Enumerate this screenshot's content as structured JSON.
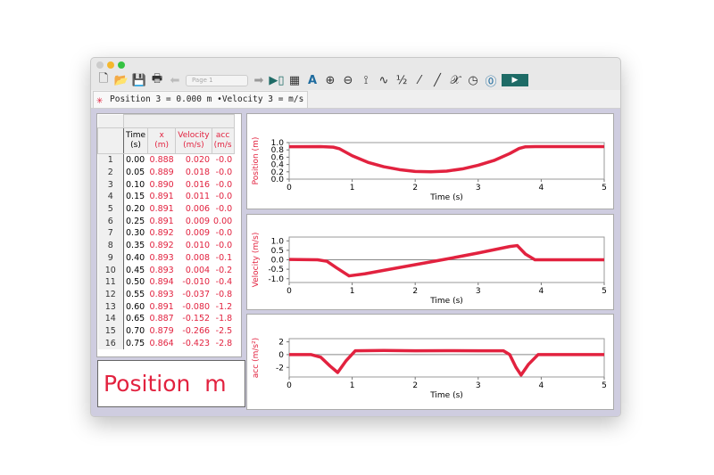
{
  "toolbar": {
    "page_select": "Page 1",
    "icons": [
      "new-file",
      "open-file",
      "save",
      "print",
      "back-arrow",
      "page-select",
      "forward-arrow",
      "data-browser",
      "calculator",
      "autoscale",
      "zoom-in",
      "zoom-out",
      "examine",
      "interpolate",
      "integral",
      "tangent",
      "linear-fit",
      "curve-fit",
      "stopwatch",
      "zero",
      "collect"
    ]
  },
  "tab": {
    "label": "Position 3 = 0.000 m •Velocity 3 =  m/s"
  },
  "table": {
    "headers": [
      {
        "name": "Time",
        "unit": "(s)"
      },
      {
        "name": "x",
        "unit": "(m)"
      },
      {
        "name": "Velocity",
        "unit": "(m/s)"
      },
      {
        "name": "acc",
        "unit": "(m/s"
      }
    ],
    "rows": [
      [
        "1",
        "0.00",
        "0.888",
        "0.020",
        "-0.0"
      ],
      [
        "2",
        "0.05",
        "0.889",
        "0.018",
        "-0.0"
      ],
      [
        "3",
        "0.10",
        "0.890",
        "0.016",
        "-0.0"
      ],
      [
        "4",
        "0.15",
        "0.891",
        "0.011",
        "-0.0"
      ],
      [
        "5",
        "0.20",
        "0.891",
        "0.006",
        "-0.0"
      ],
      [
        "6",
        "0.25",
        "0.891",
        "0.009",
        "0.00"
      ],
      [
        "7",
        "0.30",
        "0.892",
        "0.009",
        "-0.0"
      ],
      [
        "8",
        "0.35",
        "0.892",
        "0.010",
        "-0.0"
      ],
      [
        "9",
        "0.40",
        "0.893",
        "0.008",
        "-0.1"
      ],
      [
        "10",
        "0.45",
        "0.893",
        "0.004",
        "-0.2"
      ],
      [
        "11",
        "0.50",
        "0.894",
        "-0.010",
        "-0.4"
      ],
      [
        "12",
        "0.55",
        "0.893",
        "-0.037",
        "-0.8"
      ],
      [
        "13",
        "0.60",
        "0.891",
        "-0.080",
        "-1.2"
      ],
      [
        "14",
        "0.65",
        "0.887",
        "-0.152",
        "-1.8"
      ],
      [
        "15",
        "0.70",
        "0.879",
        "-0.266",
        "-2.5"
      ],
      [
        "16",
        "0.75",
        "0.864",
        "-0.423",
        "-2.8"
      ]
    ]
  },
  "meter": {
    "label": "Position",
    "unit": "m"
  },
  "chart_data": [
    {
      "type": "line",
      "ylabel": "Position (m)",
      "xlabel": "Time (s)",
      "xlim": [
        0,
        5
      ],
      "ylim": [
        0,
        1.0
      ],
      "yticks": [
        "0.0",
        "0.2",
        "0.4",
        "0.6",
        "0.8",
        "1.0"
      ],
      "xticks": [
        "0",
        "1",
        "2",
        "3",
        "4",
        "5"
      ],
      "color": "#e2223f",
      "x": [
        0,
        0.5,
        0.7,
        0.8,
        1.0,
        1.25,
        1.5,
        1.75,
        2.0,
        2.25,
        2.5,
        2.75,
        3.0,
        3.25,
        3.5,
        3.65,
        3.75,
        3.9,
        5
      ],
      "y": [
        0.888,
        0.89,
        0.875,
        0.83,
        0.64,
        0.46,
        0.34,
        0.26,
        0.21,
        0.2,
        0.22,
        0.28,
        0.38,
        0.51,
        0.7,
        0.84,
        0.885,
        0.89,
        0.89
      ]
    },
    {
      "type": "line",
      "ylabel": "Velocity (m/s)",
      "xlabel": "Time (s)",
      "xlim": [
        0,
        5
      ],
      "ylim": [
        -1.2,
        1.2
      ],
      "yticks": [
        "-1.0",
        "-0.5",
        "0.0",
        "0.5",
        "1.0"
      ],
      "xticks": [
        "0",
        "1",
        "2",
        "3",
        "4",
        "5"
      ],
      "color": "#e2223f",
      "x": [
        0,
        0.45,
        0.6,
        0.75,
        0.95,
        1.2,
        1.5,
        2.0,
        2.5,
        3.0,
        3.5,
        3.62,
        3.75,
        3.9,
        5
      ],
      "y": [
        0.02,
        0.0,
        -0.08,
        -0.42,
        -0.85,
        -0.74,
        -0.56,
        -0.26,
        0.04,
        0.36,
        0.7,
        0.75,
        0.3,
        0.0,
        0.0
      ]
    },
    {
      "type": "line",
      "ylabel": "acc (m/s²)",
      "xlabel": "Time (s)",
      "xlim": [
        0,
        5
      ],
      "ylim": [
        -3.5,
        2.5
      ],
      "yticks": [
        "-2",
        "0",
        "2"
      ],
      "xticks": [
        "0",
        "1",
        "2",
        "3",
        "4",
        "5"
      ],
      "color": "#e2223f",
      "x": [
        0,
        0.35,
        0.5,
        0.65,
        0.77,
        0.9,
        1.05,
        1.5,
        2.0,
        2.5,
        3.0,
        3.4,
        3.5,
        3.6,
        3.68,
        3.8,
        3.95,
        5
      ],
      "y": [
        0,
        0,
        -0.4,
        -1.8,
        -2.8,
        -1.0,
        0.6,
        0.65,
        0.6,
        0.62,
        0.6,
        0.6,
        0.0,
        -2.0,
        -3.2,
        -1.5,
        0,
        0
      ]
    }
  ]
}
